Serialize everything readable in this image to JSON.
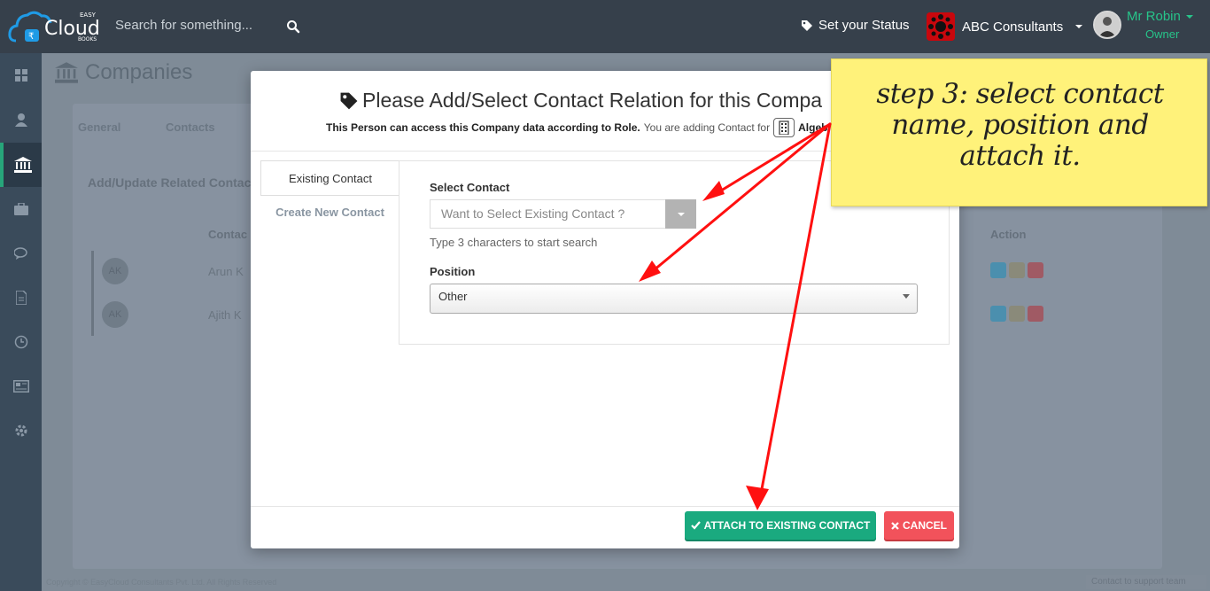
{
  "topbar": {
    "logo_word": "Cloud",
    "logo_top": "EASY",
    "logo_bottom": "BOOKS",
    "search_placeholder": "Search for something...",
    "status_label": "Set your Status",
    "company_name": "ABC Consultants",
    "user_name": "Mr Robin",
    "user_role": "Owner"
  },
  "sidebar": {
    "items": [
      "dashboard-icon",
      "user-icon",
      "bank-icon",
      "briefcase-icon",
      "chat-icon",
      "document-icon",
      "clock-icon",
      "newspaper-icon",
      "gear-icon"
    ],
    "active": "bank-icon"
  },
  "background": {
    "page_title": "Companies",
    "tabs": [
      "General",
      "Contacts"
    ],
    "section_title": "Add/Update Related Contac",
    "column_contact": "Contac",
    "column_action": "Action",
    "rows": [
      {
        "initials": "AK",
        "name": "Arun K"
      },
      {
        "initials": "AK",
        "name": "Ajith K"
      }
    ],
    "footer_copyright": "Copyright © EasyCloud Consultants Pvt. Ltd. All Rights Reserved",
    "footer_support": "Contact to support team"
  },
  "modal": {
    "title": "Please Add/Select Contact Relation for this Compa",
    "subtitle_bold": "This Person can access this Company data according to Role.",
    "subtitle_rest": "You are adding Contact for",
    "subtitle_company": "Algebraa Softw",
    "tab_existing": "Existing Contact",
    "tab_create": "Create New Contact",
    "select_contact_label": "Select Contact",
    "contact_placeholder": "Want to Select Existing Contact ?",
    "search_hint": "Type 3 characters to start search",
    "position_label": "Position",
    "position_value": "Other",
    "attach_button": "ATTACH TO EXISTING CONTACT",
    "cancel_button": "CANCEL"
  },
  "annotation": {
    "note_text": "step 3: select contact name, position and attach it.",
    "note_color": "#fff27a",
    "arrow_color": "#ff0000"
  },
  "colors": {
    "topbar": "#36404b",
    "accent_green": "#1aaa7f",
    "danger_red": "#f2525b",
    "user_green": "#27c48a"
  }
}
